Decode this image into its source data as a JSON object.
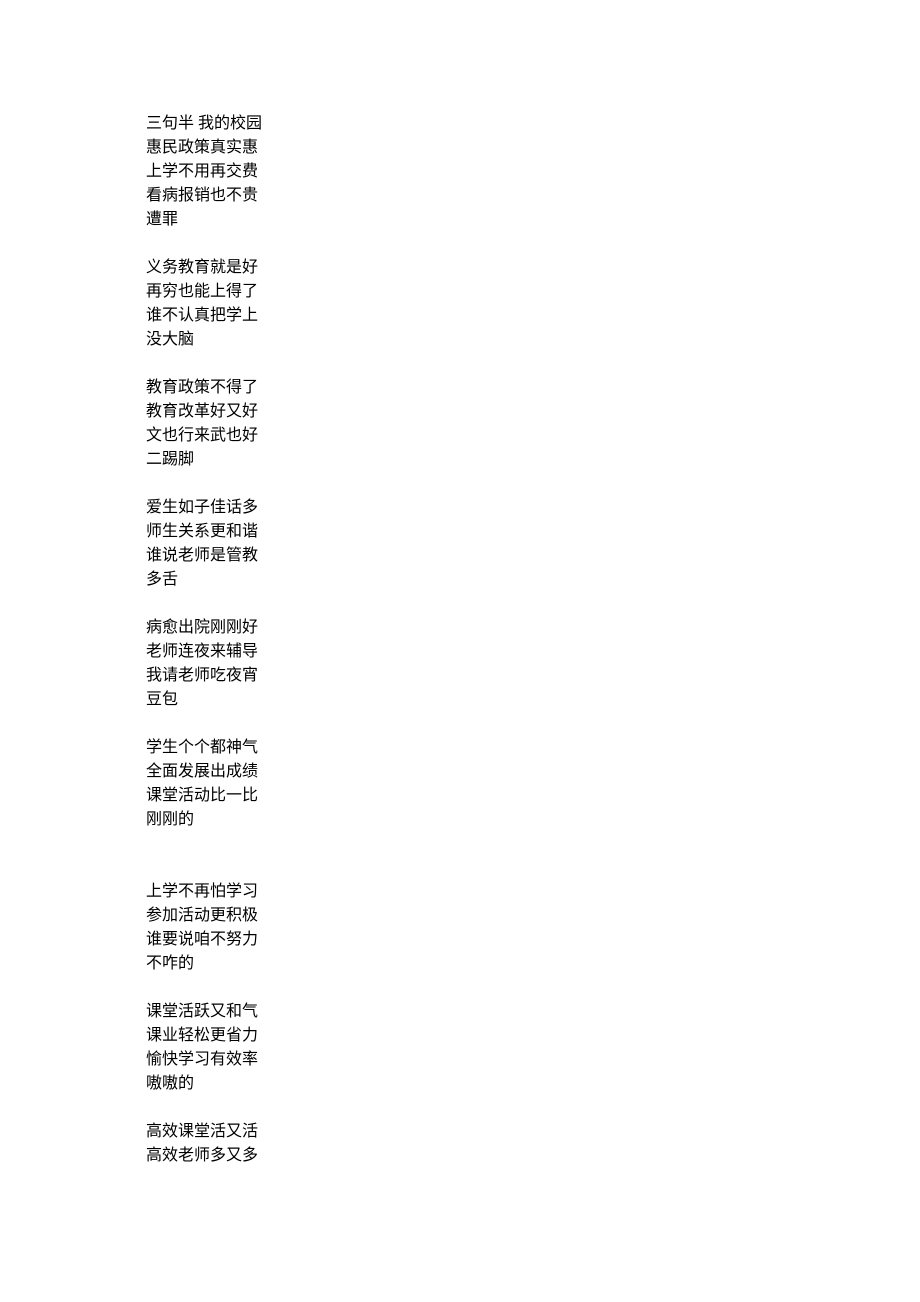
{
  "stanzas": [
    {
      "lines": [
        "三句半  我的校园",
        "惠民政策真实惠",
        "上学不用再交费",
        "看病报销也不贵",
        "遭罪"
      ],
      "extraGap": false
    },
    {
      "lines": [
        "义务教育就是好",
        "再穷也能上得了",
        "谁不认真把学上",
        "没大脑"
      ],
      "extraGap": false
    },
    {
      "lines": [
        "教育政策不得了",
        "教育改革好又好",
        "文也行来武也好",
        "二踢脚"
      ],
      "extraGap": false
    },
    {
      "lines": [
        "爱生如子佳话多",
        "师生关系更和谐",
        "谁说老师是管教",
        "多舌"
      ],
      "extraGap": false
    },
    {
      "lines": [
        "病愈出院刚刚好",
        "老师连夜来辅导",
        "我请老师吃夜宵",
        "豆包"
      ],
      "extraGap": false
    },
    {
      "lines": [
        "学生个个都神气",
        "全面发展出成绩",
        "课堂活动比一比",
        "刚刚的"
      ],
      "extraGap": true
    },
    {
      "lines": [
        "上学不再怕学习",
        "参加活动更积极",
        "谁要说咱不努力",
        "不咋的"
      ],
      "extraGap": false
    },
    {
      "lines": [
        "课堂活跃又和气",
        "课业轻松更省力",
        "愉快学习有效率",
        "嗷嗷的"
      ],
      "extraGap": false
    },
    {
      "lines": [
        "高效课堂活又活",
        "高效老师多又多"
      ],
      "extraGap": false
    }
  ]
}
